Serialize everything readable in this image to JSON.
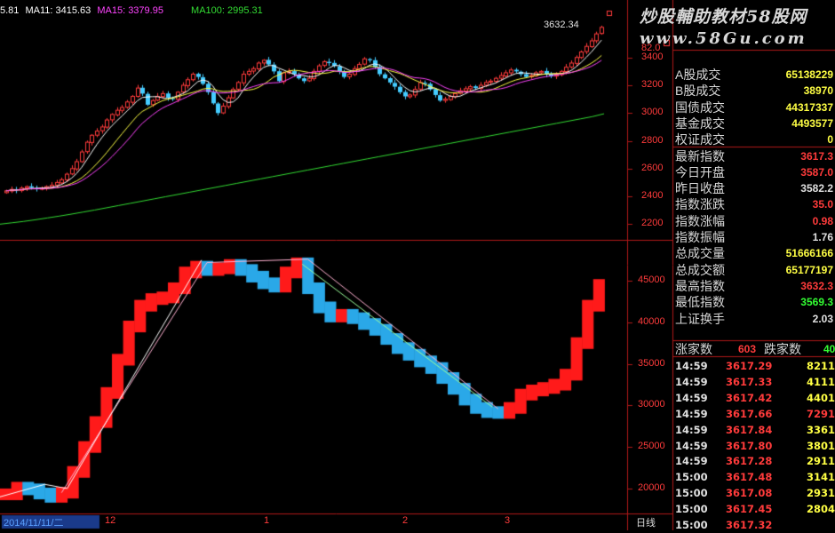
{
  "header": {
    "ma1": {
      "label": "5.81",
      "color": "#ffffff"
    },
    "ma2": {
      "label": "MA11: 3415.63",
      "color": "#ffffff"
    },
    "ma3": {
      "label": "MA15: 3379.95",
      "color": "#ff44ff"
    },
    "ma4": {
      "label": "MA100: 2995.31",
      "color": "#33dd33"
    }
  },
  "watermark": {
    "line1": "炒股輔助教材58股网",
    "line2": "www.58Gu.com"
  },
  "upper_chart": {
    "high_label": "3632.34",
    "y_ticks": [
      "3400",
      "3200",
      "3000",
      "2800",
      "2600",
      "2400",
      "2200"
    ],
    "partial_label": "82.0"
  },
  "lower_chart": {
    "y_ticks": [
      "45000",
      "40000",
      "35000",
      "30000",
      "25000",
      "20000"
    ]
  },
  "x_axis": {
    "date_label": "2014/11/11/二",
    "months": [
      "12",
      "1",
      "2",
      "3"
    ],
    "period": "日线"
  },
  "panel": {
    "rows": [
      {
        "label": "A股成交",
        "value": "65138229",
        "color": "#ffff44"
      },
      {
        "label": "B股成交",
        "value": "38970",
        "color": "#ffff44"
      },
      {
        "label": "国债成交",
        "value": "44317337",
        "color": "#ffff44"
      },
      {
        "label": "基金成交",
        "value": "4493577",
        "color": "#ffff44"
      },
      {
        "label": "权证成交",
        "value": "0",
        "color": "#ffff44"
      },
      {
        "label": "最新指数",
        "value": "3617.3",
        "color": "#ff3b3b"
      },
      {
        "label": "今日开盘",
        "value": "3587.0",
        "color": "#ff3b3b"
      },
      {
        "label": "昨日收盘",
        "value": "3582.2",
        "color": "#e0e0e0"
      },
      {
        "label": "指数涨跌",
        "value": "35.0",
        "color": "#ff3b3b"
      },
      {
        "label": "指数涨幅",
        "value": "0.98",
        "color": "#ff3b3b"
      },
      {
        "label": "指数振幅",
        "value": "1.76",
        "color": "#e0e0e0"
      },
      {
        "label": "总成交量",
        "value": "51666166",
        "color": "#ffff44"
      },
      {
        "label": "总成交额",
        "value": "65177197",
        "color": "#ffff44"
      },
      {
        "label": "最高指数",
        "value": "3632.3",
        "color": "#ff3b3b"
      },
      {
        "label": "最低指数",
        "value": "3569.3",
        "color": "#33ff33"
      },
      {
        "label": "上证换手",
        "value": "2.03",
        "color": "#e0e0e0"
      }
    ],
    "up_label": "涨家数",
    "up_count": "603",
    "down_label": "跌家数",
    "down_count": "40",
    "ticks": [
      {
        "time": "14:59",
        "price": "3617.29",
        "vol": "8211",
        "vcolor": "#ffff44"
      },
      {
        "time": "14:59",
        "price": "3617.33",
        "vol": "4111",
        "vcolor": "#ffff44"
      },
      {
        "time": "14:59",
        "price": "3617.42",
        "vol": "4401",
        "vcolor": "#ffff44"
      },
      {
        "time": "14:59",
        "price": "3617.66",
        "vol": "7291",
        "vcolor": "#ff3b3b"
      },
      {
        "time": "14:59",
        "price": "3617.84",
        "vol": "3361",
        "vcolor": "#ffff44"
      },
      {
        "time": "14:59",
        "price": "3617.80",
        "vol": "3801",
        "vcolor": "#ffff44"
      },
      {
        "time": "14:59",
        "price": "3617.28",
        "vol": "2911",
        "vcolor": "#ffff44"
      },
      {
        "time": "15:00",
        "price": "3617.48",
        "vol": "3141",
        "vcolor": "#ffff44"
      },
      {
        "time": "15:00",
        "price": "3617.08",
        "vol": "2931",
        "vcolor": "#ffff44"
      },
      {
        "time": "15:00",
        "price": "3617.45",
        "vol": "2804",
        "vcolor": "#ffff44"
      },
      {
        "time": "15:00",
        "price": "3617.32",
        "vol": "",
        "vcolor": "#ffff44"
      }
    ]
  },
  "chart_data": [
    {
      "type": "candlestick",
      "title": "",
      "ylim": [
        2100,
        3750
      ],
      "y_ticks": [
        2200,
        2400,
        2600,
        2800,
        3000,
        3200,
        3400
      ],
      "closes": [
        2440,
        2450,
        2445,
        2460,
        2470,
        2462,
        2455,
        2458,
        2470,
        2480,
        2500,
        2520,
        2560,
        2600,
        2650,
        2720,
        2790,
        2840,
        2870,
        2900,
        2950,
        2990,
        3020,
        3040,
        3080,
        3120,
        3180,
        3140,
        3060,
        3090,
        3120,
        3140,
        3110,
        3100,
        3150,
        3200,
        3240,
        3280,
        3260,
        3210,
        3150,
        3070,
        3000,
        3050,
        3110,
        3170,
        3220,
        3280,
        3300,
        3320,
        3360,
        3380,
        3350,
        3300,
        3230,
        3290,
        3300,
        3280,
        3250,
        3230,
        3250,
        3300,
        3340,
        3370,
        3360,
        3340,
        3300,
        3260,
        3280,
        3320,
        3350,
        3390,
        3380,
        3330,
        3280,
        3250,
        3220,
        3190,
        3150,
        3120,
        3130,
        3170,
        3220,
        3210,
        3170,
        3130,
        3090,
        3100,
        3120,
        3140,
        3160,
        3175,
        3190,
        3180,
        3200,
        3220,
        3230,
        3250,
        3270,
        3290,
        3310,
        3300,
        3280,
        3260,
        3270,
        3290,
        3300,
        3280,
        3265,
        3280,
        3300,
        3330,
        3360,
        3400,
        3440,
        3480,
        3520,
        3570,
        3617
      ],
      "series": [
        {
          "values": [],
          "color": "#ffffff"
        },
        {
          "values": [],
          "color": "#ffff44"
        },
        {
          "values": [],
          "color": "#ff44ff"
        },
        {
          "name": "MA100",
          "values": [
            2200,
            2210,
            2220,
            2232,
            2245,
            2258,
            2272,
            2287,
            2302,
            2318,
            2334,
            2350,
            2366,
            2382,
            2398,
            2414,
            2430,
            2446,
            2462,
            2478,
            2494,
            2510,
            2526,
            2542,
            2558,
            2574,
            2590,
            2606,
            2622,
            2638,
            2654,
            2670,
            2686,
            2702,
            2718,
            2734,
            2750,
            2766,
            2782,
            2798,
            2814,
            2830,
            2846,
            2862,
            2878,
            2894,
            2910,
            2926,
            2942,
            2958,
            2974,
            2995
          ],
          "color": "#33dd33"
        }
      ]
    },
    {
      "type": "step",
      "ylim": [
        17000,
        49500
      ],
      "y_ticks": [
        20000,
        25000,
        30000,
        35000,
        40000,
        45000
      ],
      "values": [
        19800,
        20600,
        20400,
        19900,
        19500,
        20000,
        22500,
        25500,
        28500,
        32000,
        36000,
        40000,
        42500,
        43300,
        43500,
        44600,
        46500,
        47200,
        46800,
        47000,
        47400,
        46800,
        46000,
        45200,
        44800,
        46500,
        47600,
        44600,
        42300,
        41200,
        41400,
        41000,
        40300,
        39600,
        38500,
        37400,
        36600,
        35800,
        35000,
        33800,
        32500,
        31200,
        30200,
        29700,
        29600,
        30200,
        31800,
        32300,
        32600,
        33000,
        34200,
        38000,
        42500,
        45000
      ]
    }
  ]
}
